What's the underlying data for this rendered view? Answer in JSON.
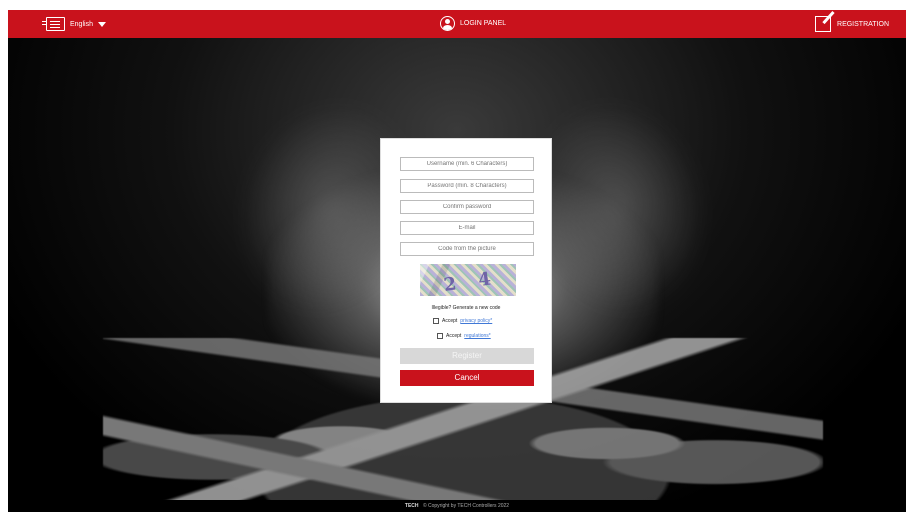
{
  "header": {
    "language": "English",
    "login": "LOGIN PANEL",
    "registration": "REGISTRATION"
  },
  "form": {
    "username_placeholder": "Username (min. 6 Characters)",
    "password_placeholder": "Password (min. 8 Characters)",
    "confirm_placeholder": "Confirm password",
    "email_placeholder": "E-mail",
    "code_placeholder": "Code from the picture",
    "captcha_text": "2 4 7",
    "illegible": "Illegible? Generate a new code",
    "accept": "Accept",
    "privacy_policy": "privacy policy*",
    "regulations": "regulations*",
    "register": "Register",
    "cancel": "Cancel"
  },
  "footer": {
    "brand": "TECH",
    "copyright": "© Copyright by TECH Controllers 2022"
  },
  "colors": {
    "accent": "#c9121c",
    "disabled": "#d8d8d8",
    "link": "#4078d6"
  },
  "icons": {
    "language": "list-icon",
    "login": "user-circle-icon",
    "registration": "edit-icon"
  }
}
